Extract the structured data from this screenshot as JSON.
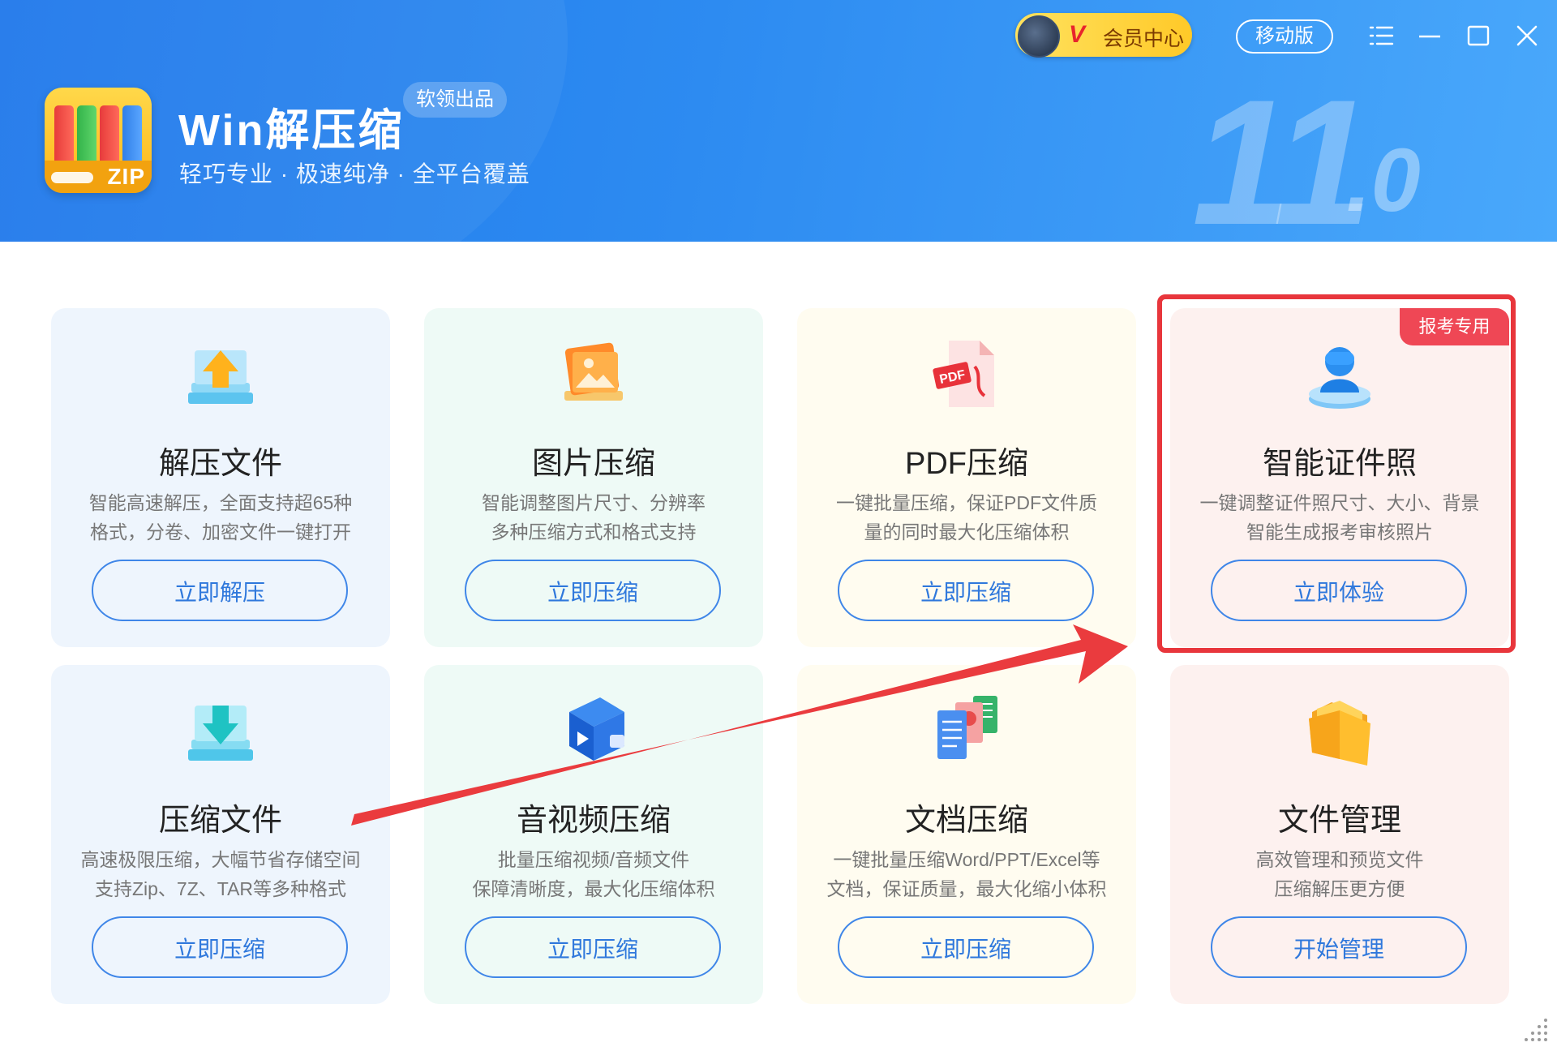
{
  "header": {
    "app_title": "Win解压缩",
    "brand_badge": "软领出品",
    "subtitle": "轻巧专业 · 极速纯净 · 全平台覆盖",
    "version_major": "11",
    "version_minor": ".0",
    "logo_text": "ZIP",
    "vip_label": "会员中心",
    "vip_mark": "V",
    "mobile_label": "移动版"
  },
  "cards": [
    {
      "title": "解压文件",
      "desc": [
        "智能高速解压，全面支持超65种",
        "格式，分卷、加密文件一键打开"
      ],
      "button": "立即解压",
      "icon": "extract-icon"
    },
    {
      "title": "图片压缩",
      "desc": [
        "智能调整图片尺寸、分辨率",
        "多种压缩方式和格式支持"
      ],
      "button": "立即压缩",
      "icon": "image-icon"
    },
    {
      "title": "PDF压缩",
      "desc": [
        "一键批量压缩，保证PDF文件质",
        "量的同时最大化压缩体积"
      ],
      "button": "立即压缩",
      "icon": "pdf-icon"
    },
    {
      "title": "智能证件照",
      "desc": [
        "一键调整证件照尺寸、大小、背景",
        "智能生成报考审核照片"
      ],
      "button": "立即体验",
      "icon": "id-photo-icon",
      "badge": "报考专用"
    },
    {
      "title": "压缩文件",
      "desc": [
        "高速极限压缩，大幅节省存储空间",
        "支持Zip、7Z、TAR等多种格式"
      ],
      "button": "立即压缩",
      "icon": "compress-icon"
    },
    {
      "title": "音视频压缩",
      "desc": [
        "批量压缩视频/音频文件",
        "保障清晰度，最大化压缩体积"
      ],
      "button": "立即压缩",
      "icon": "video-icon"
    },
    {
      "title": "文档压缩",
      "desc": [
        "一键批量压缩Word/PPT/Excel等",
        "文档，保证质量，最大化缩小体积"
      ],
      "button": "立即压缩",
      "icon": "document-icon"
    },
    {
      "title": "文件管理",
      "desc": [
        "高效管理和预览文件",
        "压缩解压更方便"
      ],
      "button": "开始管理",
      "icon": "folder-icon"
    }
  ],
  "colors": {
    "header_blue": "#2d8bf1",
    "button_blue": "#2f78dc",
    "highlight_red": "#e8363c"
  }
}
